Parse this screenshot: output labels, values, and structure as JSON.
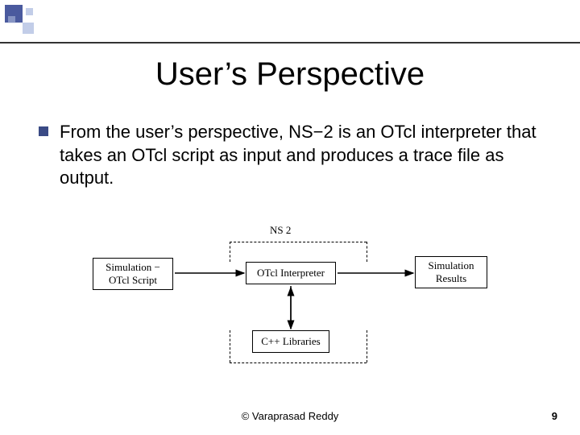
{
  "title": "User’s Perspective",
  "bullet": "From the user’s perspective, NS−2 is an OTcl interpreter that takes an OTcl script as input and produces a trace file as output.",
  "diagram": {
    "label_top": "NS  2",
    "box_left_l1": "Simulation −",
    "box_left_l2": "OTcl Script",
    "box_mid": "OTcl Interpreter",
    "box_right_l1": "Simulation",
    "box_right_l2": "Results",
    "box_bottom": "C++ Libraries"
  },
  "footer": "©  Varaprasad Reddy",
  "page": "9"
}
